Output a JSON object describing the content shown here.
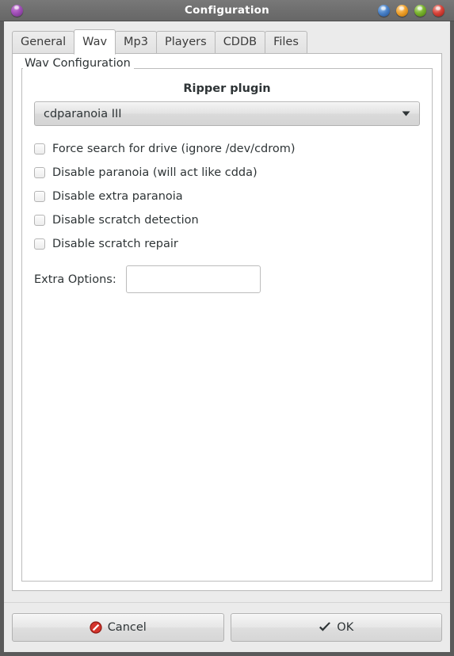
{
  "window": {
    "title": "Configuration",
    "menu_icon": "app-menu-orb-icon",
    "buttons": [
      {
        "name": "shade-button",
        "icon": "orb-blue-icon",
        "color": "#4a82c8"
      },
      {
        "name": "minimize-button",
        "icon": "orb-orange-icon",
        "color": "#f0a22e"
      },
      {
        "name": "maximize-button",
        "icon": "orb-green-icon",
        "color": "#7ab42e"
      },
      {
        "name": "close-button",
        "icon": "orb-red-icon",
        "color": "#d8443a"
      }
    ]
  },
  "tabs": [
    {
      "label": "General",
      "active": false
    },
    {
      "label": "Wav",
      "active": true
    },
    {
      "label": "Mp3",
      "active": false
    },
    {
      "label": "Players",
      "active": false
    },
    {
      "label": "CDDB",
      "active": false
    },
    {
      "label": "Files",
      "active": false
    }
  ],
  "group": {
    "label": "Wav Configuration"
  },
  "ripper": {
    "title": "Ripper plugin",
    "selected": "cdparanoia III",
    "arrow_icon": "chevron-down-icon"
  },
  "checkboxes": [
    {
      "label": "Force search for drive (ignore /dev/cdrom)",
      "checked": false
    },
    {
      "label": "Disable paranoia (will act like cdda)",
      "checked": false
    },
    {
      "label": "Disable extra paranoia",
      "checked": false
    },
    {
      "label": "Disable scratch detection",
      "checked": false
    },
    {
      "label": "Disable scratch repair",
      "checked": false
    }
  ],
  "extra_options": {
    "label": "Extra Options:",
    "value": "",
    "placeholder": ""
  },
  "actions": {
    "cancel": {
      "label": "Cancel",
      "icon": "no-entry-icon",
      "icon_color": "#cc0000"
    },
    "ok": {
      "label": "OK",
      "icon": "check-icon",
      "icon_color": "#2e3436"
    }
  }
}
